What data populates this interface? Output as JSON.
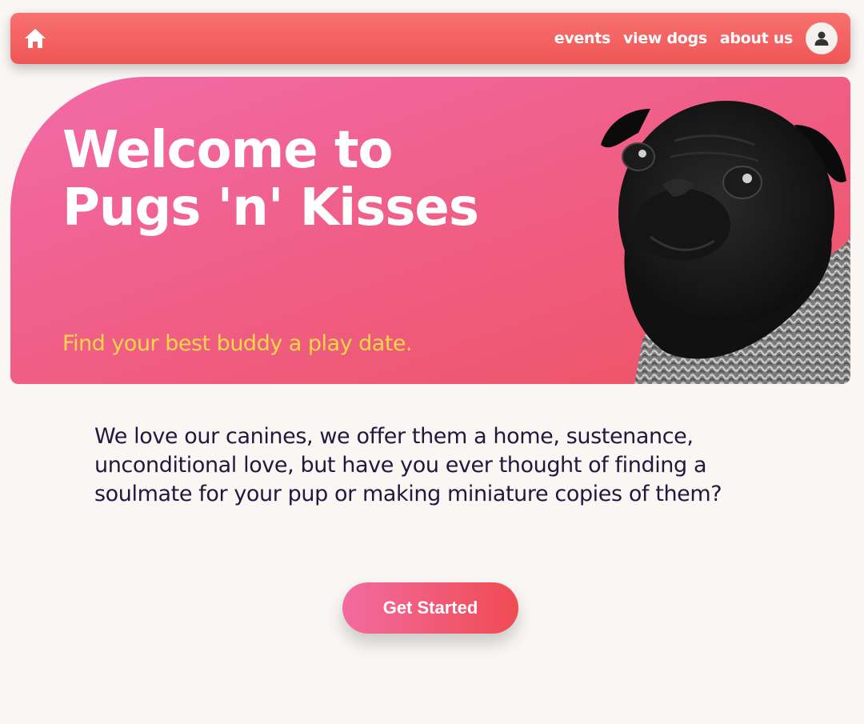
{
  "nav": {
    "home_icon": "home-icon",
    "links": [
      {
        "label": "events"
      },
      {
        "label": "view dogs"
      },
      {
        "label": "about us"
      }
    ],
    "avatar_icon": "user-icon"
  },
  "hero": {
    "title": "Welcome to Pugs 'n' Kisses",
    "subtitle": "Find your best buddy a play date.",
    "image": "black-pug-in-knit-scarf"
  },
  "intro": {
    "text": "We love our canines, we offer them a home, sustenance, unconditional love, but have you ever thought of finding a soulmate for your pup or making miniature copies of them?"
  },
  "cta": {
    "label": "Get Started"
  },
  "colors": {
    "background": "#f9f6f3",
    "nav_start": "#f8716f",
    "nav_end": "#ef5656",
    "hero_start": "#f26ba8",
    "hero_end": "#ee5362",
    "subtitle": "#fbd74a",
    "body_text": "#1f1a3d"
  }
}
